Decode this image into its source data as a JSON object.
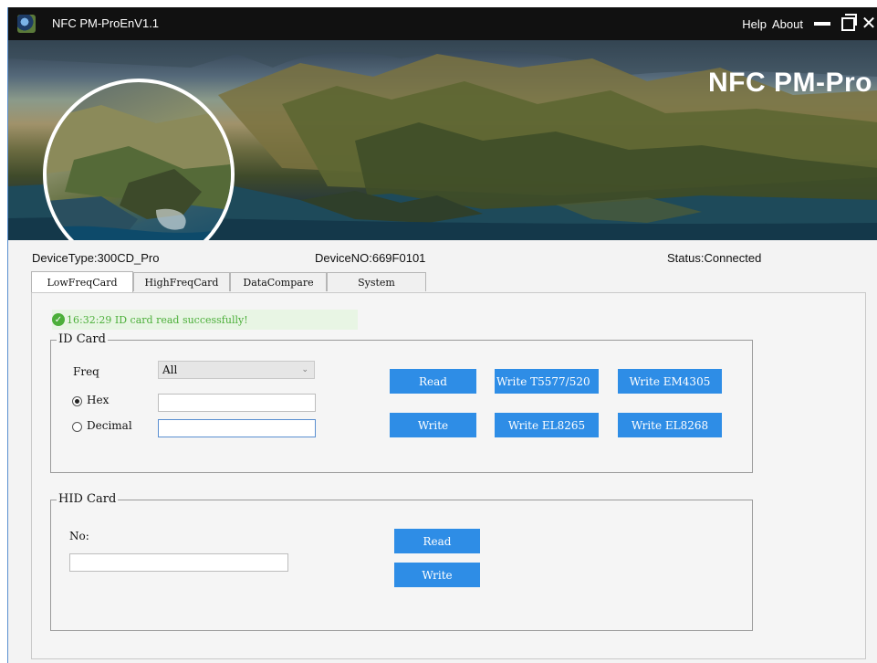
{
  "titlebar": {
    "title": "NFC PM-ProEnV1.1",
    "help_label": "Help",
    "about_label": "About",
    "close_glyph": "✕"
  },
  "banner": {
    "brand": "NFC PM-Pro"
  },
  "info": {
    "device_type": "DeviceType:300CD_Pro",
    "device_no": "DeviceNO:669F0101",
    "status": "Status:Connected"
  },
  "tabs": [
    {
      "label": "LowFreqCard"
    },
    {
      "label": "HighFreqCard"
    },
    {
      "label": "DataCompare"
    },
    {
      "label": "System"
    }
  ],
  "status_message": {
    "icon_glyph": "✓",
    "text": "16:32:29 ID card read successfully!"
  },
  "id_card": {
    "legend": "ID Card",
    "freq_label": "Freq",
    "freq_value": "All",
    "hex_label": "Hex",
    "decimal_label": "Decimal",
    "hex_value": "",
    "decimal_value": "",
    "selected_format": "Hex",
    "buttons": {
      "read": "Read",
      "write_t5577": "Write T5577/520",
      "write_em4305": "Write EM4305",
      "write": "Write",
      "write_el8265": "Write EL8265",
      "write_el8268": "Write EL8268"
    }
  },
  "hid_card": {
    "legend": "HID Card",
    "no_label": "No:",
    "no_value": "",
    "buttons": {
      "read": "Read",
      "write": "Write"
    }
  },
  "colors": {
    "accent": "#2e8de6",
    "success": "#4caf3a",
    "titlebar": "#111111"
  }
}
